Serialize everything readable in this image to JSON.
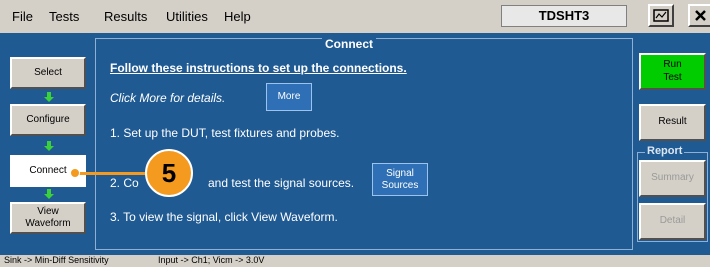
{
  "menu": {
    "items": [
      "File",
      "Tests",
      "Results",
      "Utilities",
      "Help"
    ],
    "app_title": "TDSHT3"
  },
  "icons": {
    "restore": "restore-window-icon",
    "close": "close-x-icon",
    "arrow": "green-down-arrow-icon"
  },
  "sidebar": {
    "select": "Select",
    "configure": "Configure",
    "connect": "Connect",
    "view_waveform_line1": "View",
    "view_waveform_line2": "Waveform"
  },
  "content": {
    "frame_title": "Connect",
    "heading": "Follow these instructions to set up the connections.",
    "click_more": "Click More for details.",
    "more_button": "More",
    "step1": "1. Set up the DUT, test fixtures and probes.",
    "step2_prefix": "2. Co",
    "step2_text": "and test the signal sources.",
    "signal_sources_line1": "Signal",
    "signal_sources_line2": "Sources",
    "step3": "3. To view the signal, click View Waveform."
  },
  "callout": {
    "number": "5"
  },
  "right_panel": {
    "run_line1": "Run",
    "run_line2": "Test",
    "result": "Result",
    "report_title": "Report",
    "summary": "Summary",
    "detail": "Detail"
  },
  "status": {
    "left": "Sink -> Min-Diff Sensitivity",
    "right": "Input -> Ch1; Vicm -> 3.0V"
  },
  "colors": {
    "panel_blue": "#1f5a93",
    "callout_orange": "#f39a1f",
    "run_green": "#00cc00"
  }
}
